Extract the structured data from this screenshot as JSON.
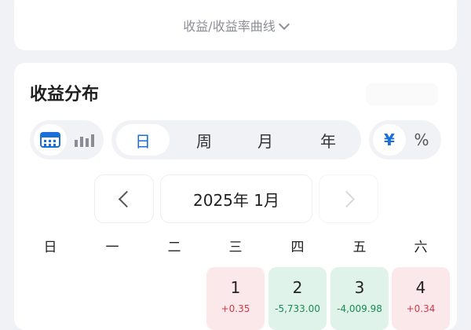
{
  "top_card": {
    "curve_toggle_label": "收益/收益率曲线",
    "chevron_icon": "chevron-down-icon"
  },
  "distribution": {
    "title": "收益分布",
    "view_modes": [
      {
        "icon": "calendar-icon",
        "active": true
      },
      {
        "icon": "bar-chart-icon",
        "active": false
      }
    ],
    "periods": [
      {
        "label": "日",
        "active": true
      },
      {
        "label": "周",
        "active": false
      },
      {
        "label": "月",
        "active": false
      },
      {
        "label": "年",
        "active": false
      }
    ],
    "units": [
      {
        "label": "¥",
        "active": true
      },
      {
        "label": "%",
        "active": false
      }
    ],
    "month_nav": {
      "current": "2025年 1月",
      "prev_icon": "chevron-left-icon",
      "next_icon": "chevron-right-icon"
    },
    "weekdays": [
      "日",
      "一",
      "二",
      "三",
      "四",
      "五",
      "六"
    ],
    "days": [
      {
        "day": "1",
        "value": "+0.35",
        "trend": "up"
      },
      {
        "day": "2",
        "value": "-5,733.00",
        "trend": "down"
      },
      {
        "day": "3",
        "value": "-4,009.98",
        "trend": "down"
      },
      {
        "day": "4",
        "value": "+0.34",
        "trend": "up"
      }
    ],
    "colors": {
      "accent": "#1a6fd8",
      "gain_bg": "#fbe8ea",
      "gain_text": "#d23a48",
      "loss_bg": "#dff3ea",
      "loss_text": "#1b8a56"
    }
  }
}
